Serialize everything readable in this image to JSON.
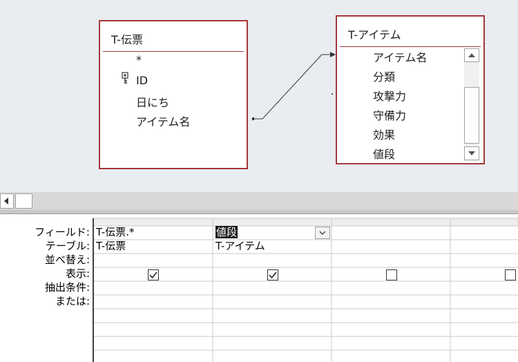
{
  "tables": [
    {
      "title": "T-伝票",
      "fields": [
        "*",
        "ID",
        "日にち",
        "アイテム名"
      ],
      "key_field": "ID"
    },
    {
      "title": "T-アイテム",
      "fields": [
        "アイテム名",
        "分類",
        "攻撃力",
        "守備力",
        "効果",
        "値段"
      ]
    }
  ],
  "grid": {
    "row_labels": [
      "フィールド:",
      "テーブル:",
      "並べ替え:",
      "表示:",
      "抽出条件:",
      "または:"
    ],
    "columns": [
      {
        "field": "T-伝票.*",
        "table": "T-伝票",
        "show": true
      },
      {
        "field": "値段",
        "table": "T-アイテム",
        "show": true,
        "selected": true
      },
      {
        "field": "",
        "table": "",
        "show": false
      },
      {
        "field": "",
        "table": "",
        "show": false
      }
    ]
  },
  "colors": {
    "table_border": "#a4373a",
    "canvas_bg": "#e9ecf0",
    "grid_line": "#c8c8c8"
  },
  "icons": {
    "primary_key": "key-icon",
    "scroll_up": "triangle-up-icon",
    "scroll_down": "triangle-down-icon",
    "scroll_left": "triangle-left-icon",
    "dropdown": "chevron-down-icon",
    "checkbox": "checkmark-icon"
  }
}
